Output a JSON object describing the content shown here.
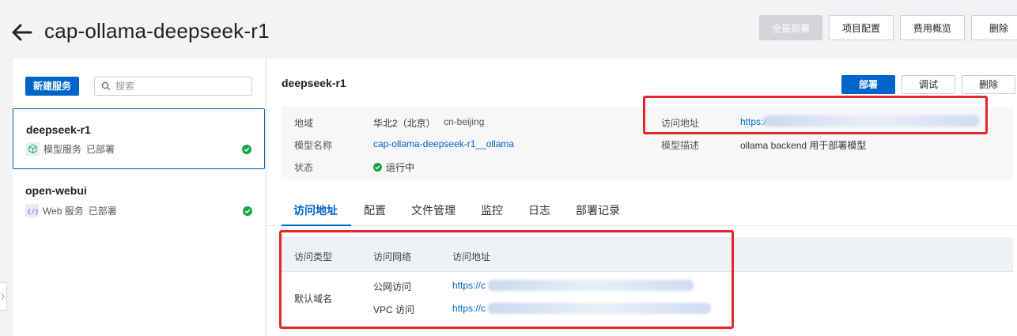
{
  "header": {
    "title": "cap-ollama-deepseek-r1",
    "buttons": {
      "deploy_all": "全量部署",
      "project_config": "项目配置",
      "cost_overview": "费用概览",
      "delete": "删除"
    }
  },
  "sidebar": {
    "new_service": "新建服务",
    "search_placeholder": "搜索",
    "services": [
      {
        "name": "deepseek-r1",
        "type": "模型服务",
        "status": "已部署"
      },
      {
        "name": "open-webui",
        "type": "Web 服务",
        "status": "已部署"
      }
    ]
  },
  "main": {
    "service_title": "deepseek-r1",
    "actions": {
      "deploy": "部署",
      "debug": "调试",
      "delete": "删除"
    },
    "info": {
      "region_label": "地域",
      "region_value": "华北2（北京）",
      "region_code": "cn-beijing",
      "model_name_label": "模型名称",
      "model_name_value": "cap-ollama-deepseek-r1__ollama",
      "status_label": "状态",
      "status_value": "运行中",
      "access_url_label": "访问地址",
      "access_url_value": "https:/",
      "model_desc_label": "模型描述",
      "model_desc_value": "ollama backend 用于部署模型"
    },
    "tabs": [
      "访问地址",
      "配置",
      "文件管理",
      "监控",
      "日志",
      "部署记录"
    ],
    "table": {
      "headers": [
        "访问类型",
        "访问网络",
        "访问地址"
      ],
      "row_type": "默认域名",
      "rows": [
        {
          "network": "公网访问",
          "url": "https://c"
        },
        {
          "network": "VPC 访问",
          "url": "https://c"
        }
      ]
    }
  },
  "colors": {
    "primary": "#0064c8",
    "success": "#17a34a",
    "highlight": "#e5262b",
    "background": "#f2f3f5"
  }
}
